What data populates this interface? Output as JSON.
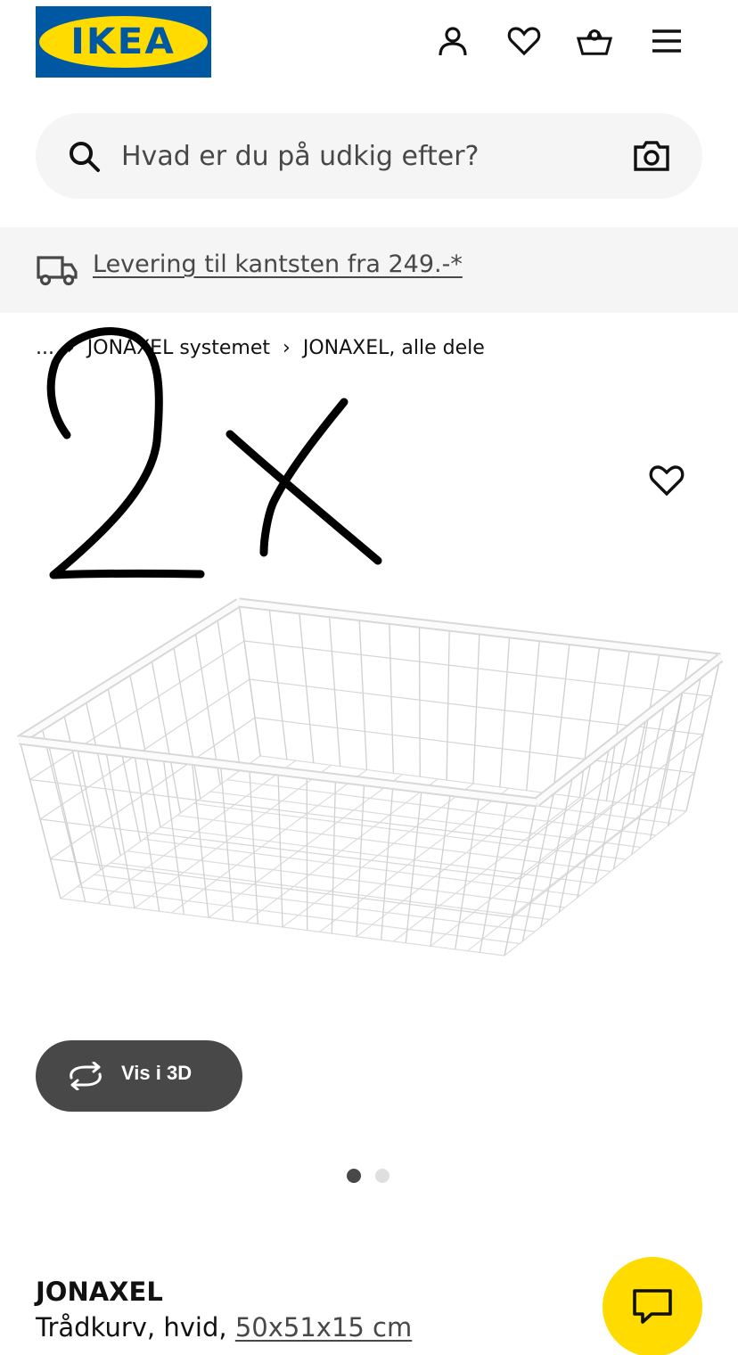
{
  "header": {
    "logo_text": "IKEA",
    "logo_reg": "®",
    "icons": [
      "user-icon",
      "heart-icon",
      "basket-icon",
      "menu-icon"
    ]
  },
  "search": {
    "placeholder": "Hvad er du på udkig efter?"
  },
  "delivery": {
    "text": "Levering til kantsten fra 249.-*"
  },
  "breadcrumb": {
    "ellipsis": "...",
    "items": [
      "JONAXEL systemet",
      "JONAXEL, alle dele"
    ],
    "separator": "›"
  },
  "annotation": {
    "text": "2x"
  },
  "gallery": {
    "vis3d_label": "Vis i 3D",
    "dots": 2,
    "active_dot": 0
  },
  "product": {
    "name": "JONAXEL",
    "description": "Trådkurv, hvid, ",
    "dimensions": "50x51x15 cm"
  },
  "colors": {
    "ikea_blue": "#0058a3",
    "ikea_yellow": "#ffdb00",
    "button_dark": "#484848",
    "surface_gray": "#f5f5f5"
  }
}
